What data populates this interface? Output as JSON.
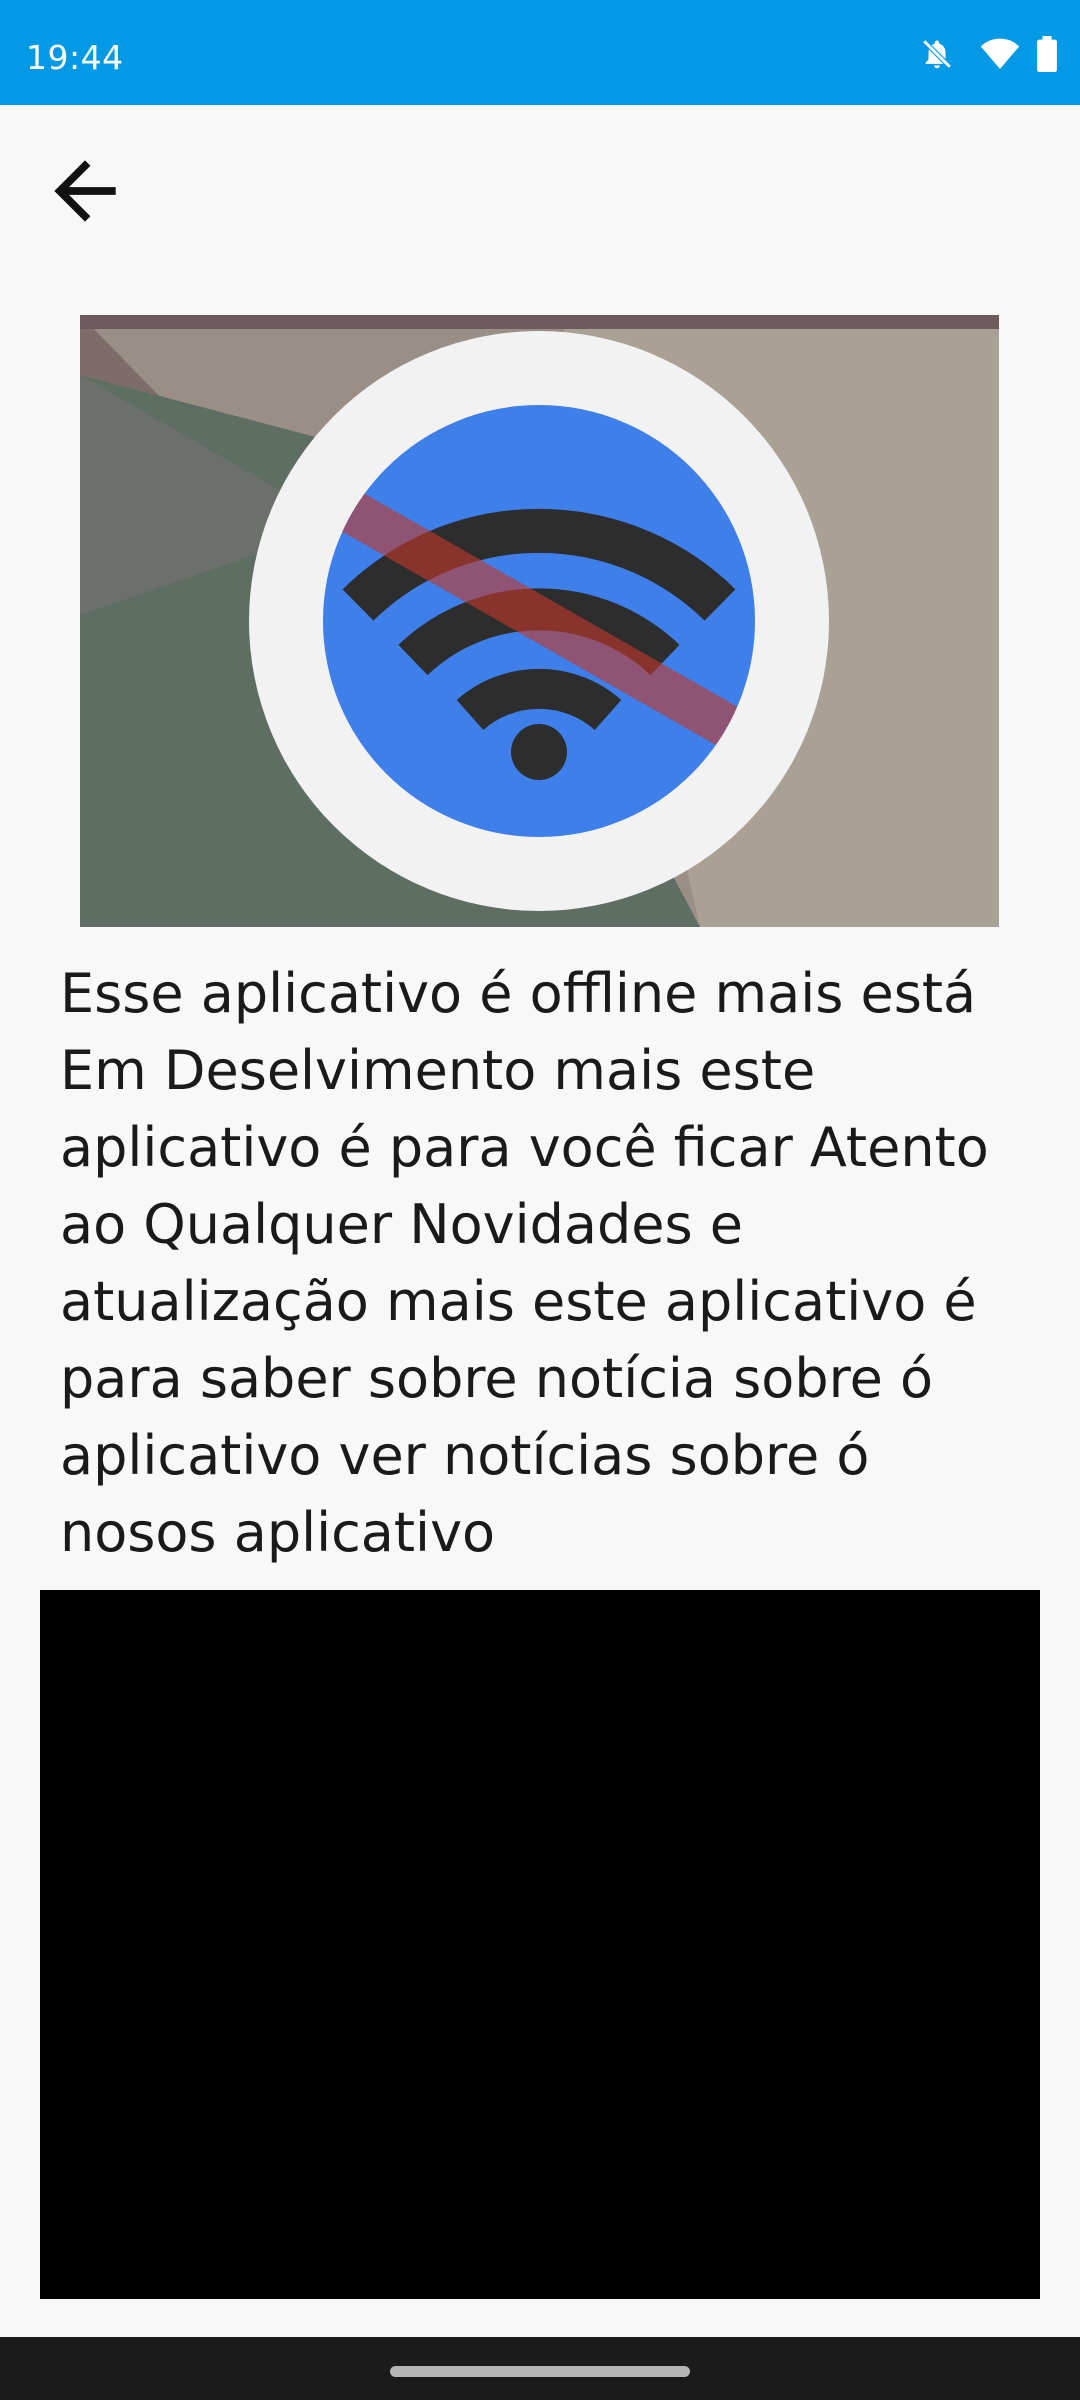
{
  "status_bar": {
    "time": "19:44",
    "icons": [
      "notifications-off-icon",
      "wifi-icon",
      "battery-icon"
    ],
    "color": "#0399e5"
  },
  "toolbar": {
    "back_icon": "arrow-back-icon"
  },
  "hero_image": {
    "icon": "wifi-off-icon",
    "colors": {
      "circle": "#3f7fea",
      "ring": "#f2f2f2",
      "bars": "#2d2d2d",
      "slash": "#c0392b"
    }
  },
  "content": {
    "description": "Esse aplicativo é offline mais está Em Deselvimento mais este aplicativo é para você ficar Atento ao Qualquer Novidades e atualização mais este aplicativo é para saber sobre notícia sobre ó aplicativo ver notícias sobre ó nosos aplicativo"
  },
  "video_area": {
    "color": "#000000"
  }
}
